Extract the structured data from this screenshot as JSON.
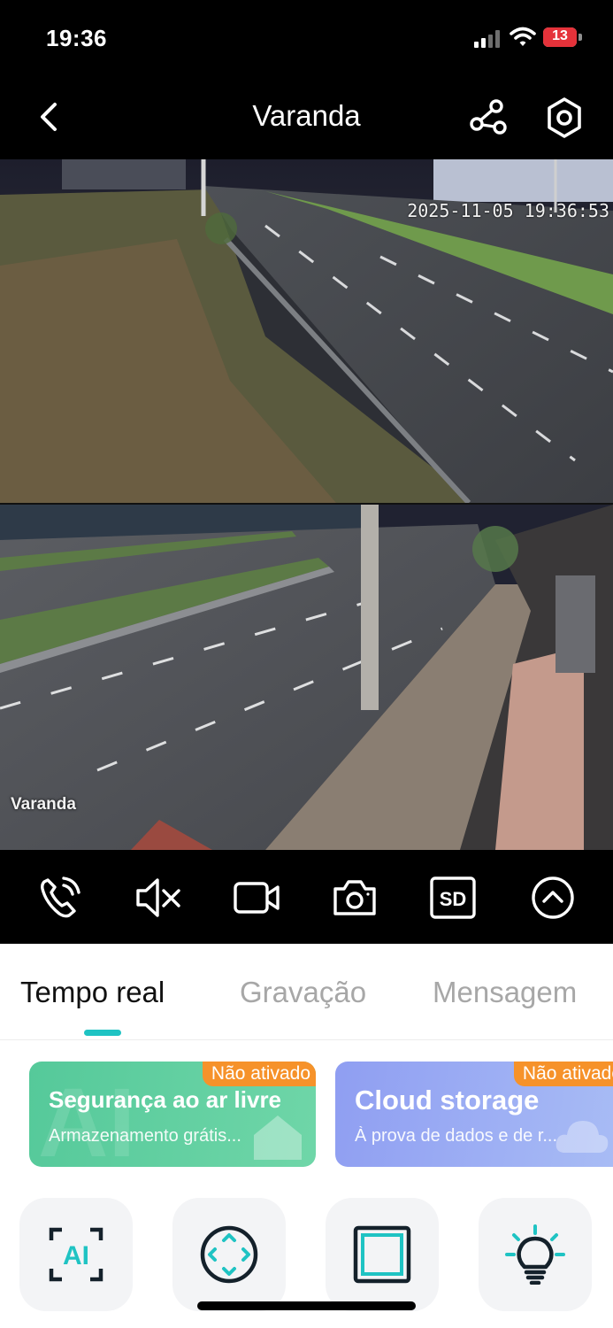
{
  "status_bar": {
    "time": "19:36",
    "battery_level": "13",
    "icons": [
      "cellular-signal-icon",
      "wifi-icon",
      "battery-icon"
    ],
    "battery_color": "#e5323a"
  },
  "header": {
    "title": "Varanda",
    "icons": [
      "back-icon",
      "share-icon",
      "settings-hexagon-icon"
    ]
  },
  "video": {
    "timestamp": "2025-11-05 19:36:53",
    "camera_label": "Varanda"
  },
  "controls": [
    {
      "name": "talk-button",
      "icon": "phone-call-icon"
    },
    {
      "name": "mute-button",
      "icon": "speaker-muted-icon"
    },
    {
      "name": "record-button",
      "icon": "video-camera-icon"
    },
    {
      "name": "snapshot-button",
      "icon": "camera-icon"
    },
    {
      "name": "quality-button",
      "icon": "sd-icon",
      "label": "SD"
    },
    {
      "name": "expand-button",
      "icon": "chevron-up-circle-icon"
    }
  ],
  "tabs": [
    {
      "label": "Tempo real",
      "active": true
    },
    {
      "label": "Gravação",
      "active": false
    },
    {
      "label": "Mensagem",
      "active": false
    }
  ],
  "banners": [
    {
      "badge": "Não ativado",
      "title": "Segurança ao ar livre",
      "subtitle": "Armazenamento grátis...",
      "color": "#5fcf9f"
    },
    {
      "badge": "Não ativado",
      "title": "Cloud storage",
      "subtitle": "À prova de dados e de r...",
      "color": "#9aaff3"
    }
  ],
  "features": [
    {
      "icon": "ai-scan-icon",
      "label": "AI"
    },
    {
      "icon": "ptz-direction-icon"
    },
    {
      "icon": "frame-icon"
    },
    {
      "icon": "light-bulb-icon"
    }
  ],
  "colors": {
    "accent": "#1fc3c3",
    "badge": "#f6922a",
    "icon_dark": "#14212b"
  }
}
